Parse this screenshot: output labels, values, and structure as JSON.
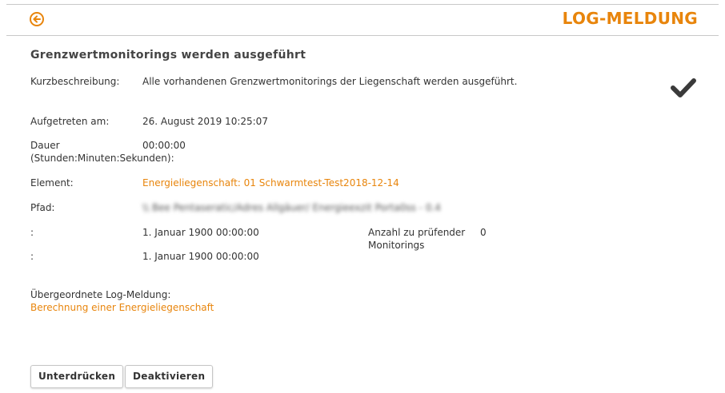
{
  "header": {
    "title": "LOG-MELDUNG",
    "back_icon": "arrow-left-circle-icon",
    "accent_color": "#e8850c"
  },
  "heading": "Grenzwertmonitorings werden ausgeführt",
  "status_icon": "check-icon",
  "fields": {
    "kurzbeschreibung": {
      "label": "Kurzbeschreibung:",
      "value": "Alle vorhandenen Grenzwertmonitorings der Liegenschaft werden ausgeführt."
    },
    "aufgetreten": {
      "label": "Aufgetreten am:",
      "value": "26. August 2019 10:25:07"
    },
    "dauer": {
      "label_line1": "Dauer",
      "label_line2": "(Stunden:Minuten:Sekunden):",
      "value": "00:00:00"
    },
    "element": {
      "label": "Element:",
      "value": "Energieliegenschaft: 01 Schwarmtest-Test2018-12-14"
    },
    "pfad": {
      "label": "Pfad:",
      "value": "\\\\ Bee Pentaseratic/Adres Allgäuer/ Energieexzit Porta0ss - 0.4"
    },
    "row1": {
      "label": ":",
      "value": "1. Januar 1900 00:00:00"
    },
    "row2": {
      "label": ":",
      "value": "1. Januar 1900 00:00:00"
    },
    "anzahl": {
      "label_line1": "Anzahl zu prüfender",
      "label_line2": "Monitorings",
      "value": "0"
    },
    "uebergeordnet": {
      "label": "Übergeordnete Log-Meldung:",
      "value": "Berechnung einer Energieliegenschaft"
    }
  },
  "buttons": {
    "suppress": "Unterdrücken",
    "deactivate": "Deaktivieren"
  }
}
